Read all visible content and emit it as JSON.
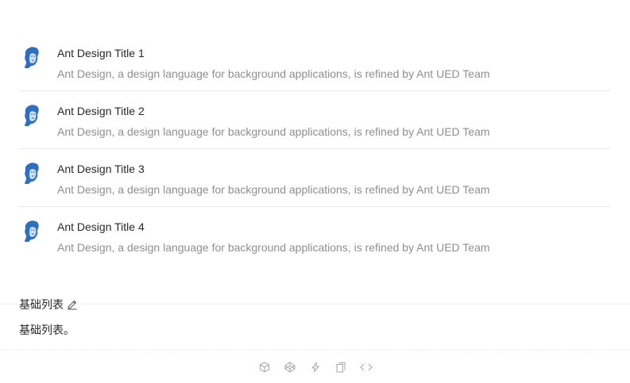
{
  "list": {
    "items": [
      {
        "title": "Ant Design Title 1",
        "description": "Ant Design, a design language for background applications, is refined by Ant UED Team"
      },
      {
        "title": "Ant Design Title 2",
        "description": "Ant Design, a design language for background applications, is refined by Ant UED Team"
      },
      {
        "title": "Ant Design Title 3",
        "description": "Ant Design, a design language for background applications, is refined by Ant UED Team"
      },
      {
        "title": "Ant Design Title 4",
        "description": "Ant Design, a design language for background applications, is refined by Ant UED Team"
      }
    ]
  },
  "demo": {
    "title": "基础列表",
    "description": "基础列表。",
    "actions": [
      {
        "icon": "codesandbox-icon"
      },
      {
        "icon": "codepen-icon"
      },
      {
        "icon": "thunderbolt-icon"
      },
      {
        "icon": "copy-icon"
      },
      {
        "icon": "code-icon"
      }
    ]
  },
  "colors": {
    "title": "#262626",
    "description": "#8c8c8c",
    "divider": "#e8e8e8",
    "avatar": "#2f6fbf"
  }
}
